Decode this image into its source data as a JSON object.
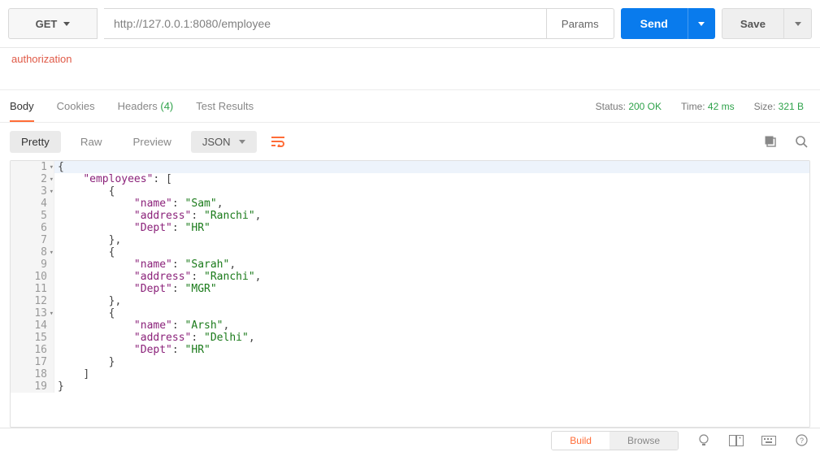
{
  "request": {
    "method": "GET",
    "url": "http://127.0.0.1:8080/employee",
    "params_label": "Params",
    "send_label": "Send",
    "save_label": "Save"
  },
  "auth_tab": "authorization",
  "response_tabs": {
    "body": "Body",
    "cookies": "Cookies",
    "headers": "Headers",
    "headers_count": "(4)",
    "tests": "Test Results"
  },
  "status": {
    "label": "Status:",
    "value": "200 OK",
    "time_label": "Time:",
    "time_value": "42 ms",
    "size_label": "Size:",
    "size_value": "321 B"
  },
  "viewer": {
    "pretty": "Pretty",
    "raw": "Raw",
    "preview": "Preview",
    "format": "JSON"
  },
  "code_lines": [
    {
      "n": 1,
      "fold": true,
      "indent": 0,
      "tokens": [
        {
          "t": "p",
          "v": "{"
        }
      ]
    },
    {
      "n": 2,
      "fold": true,
      "indent": 1,
      "tokens": [
        {
          "t": "k",
          "v": "\"employees\""
        },
        {
          "t": "p",
          "v": ": ["
        }
      ]
    },
    {
      "n": 3,
      "fold": true,
      "indent": 2,
      "tokens": [
        {
          "t": "p",
          "v": "{"
        }
      ]
    },
    {
      "n": 4,
      "indent": 3,
      "tokens": [
        {
          "t": "k",
          "v": "\"name\""
        },
        {
          "t": "p",
          "v": ": "
        },
        {
          "t": "s",
          "v": "\"Sam\""
        },
        {
          "t": "p",
          "v": ","
        }
      ]
    },
    {
      "n": 5,
      "indent": 3,
      "tokens": [
        {
          "t": "k",
          "v": "\"address\""
        },
        {
          "t": "p",
          "v": ": "
        },
        {
          "t": "s",
          "v": "\"Ranchi\""
        },
        {
          "t": "p",
          "v": ","
        }
      ]
    },
    {
      "n": 6,
      "indent": 3,
      "tokens": [
        {
          "t": "k",
          "v": "\"Dept\""
        },
        {
          "t": "p",
          "v": ": "
        },
        {
          "t": "s",
          "v": "\"HR\""
        }
      ]
    },
    {
      "n": 7,
      "indent": 2,
      "tokens": [
        {
          "t": "p",
          "v": "},"
        }
      ]
    },
    {
      "n": 8,
      "fold": true,
      "indent": 2,
      "tokens": [
        {
          "t": "p",
          "v": "{"
        }
      ]
    },
    {
      "n": 9,
      "indent": 3,
      "tokens": [
        {
          "t": "k",
          "v": "\"name\""
        },
        {
          "t": "p",
          "v": ": "
        },
        {
          "t": "s",
          "v": "\"Sarah\""
        },
        {
          "t": "p",
          "v": ","
        }
      ]
    },
    {
      "n": 10,
      "indent": 3,
      "tokens": [
        {
          "t": "k",
          "v": "\"address\""
        },
        {
          "t": "p",
          "v": ": "
        },
        {
          "t": "s",
          "v": "\"Ranchi\""
        },
        {
          "t": "p",
          "v": ","
        }
      ]
    },
    {
      "n": 11,
      "indent": 3,
      "tokens": [
        {
          "t": "k",
          "v": "\"Dept\""
        },
        {
          "t": "p",
          "v": ": "
        },
        {
          "t": "s",
          "v": "\"MGR\""
        }
      ]
    },
    {
      "n": 12,
      "indent": 2,
      "tokens": [
        {
          "t": "p",
          "v": "},"
        }
      ]
    },
    {
      "n": 13,
      "fold": true,
      "indent": 2,
      "tokens": [
        {
          "t": "p",
          "v": "{"
        }
      ]
    },
    {
      "n": 14,
      "indent": 3,
      "tokens": [
        {
          "t": "k",
          "v": "\"name\""
        },
        {
          "t": "p",
          "v": ": "
        },
        {
          "t": "s",
          "v": "\"Arsh\""
        },
        {
          "t": "p",
          "v": ","
        }
      ]
    },
    {
      "n": 15,
      "indent": 3,
      "tokens": [
        {
          "t": "k",
          "v": "\"address\""
        },
        {
          "t": "p",
          "v": ": "
        },
        {
          "t": "s",
          "v": "\"Delhi\""
        },
        {
          "t": "p",
          "v": ","
        }
      ]
    },
    {
      "n": 16,
      "indent": 3,
      "tokens": [
        {
          "t": "k",
          "v": "\"Dept\""
        },
        {
          "t": "p",
          "v": ": "
        },
        {
          "t": "s",
          "v": "\"HR\""
        }
      ]
    },
    {
      "n": 17,
      "indent": 2,
      "tokens": [
        {
          "t": "p",
          "v": "}"
        }
      ]
    },
    {
      "n": 18,
      "indent": 1,
      "tokens": [
        {
          "t": "p",
          "v": "]"
        }
      ]
    },
    {
      "n": 19,
      "indent": 0,
      "tokens": [
        {
          "t": "p",
          "v": "}"
        }
      ]
    }
  ],
  "footer": {
    "build": "Build",
    "browse": "Browse"
  }
}
